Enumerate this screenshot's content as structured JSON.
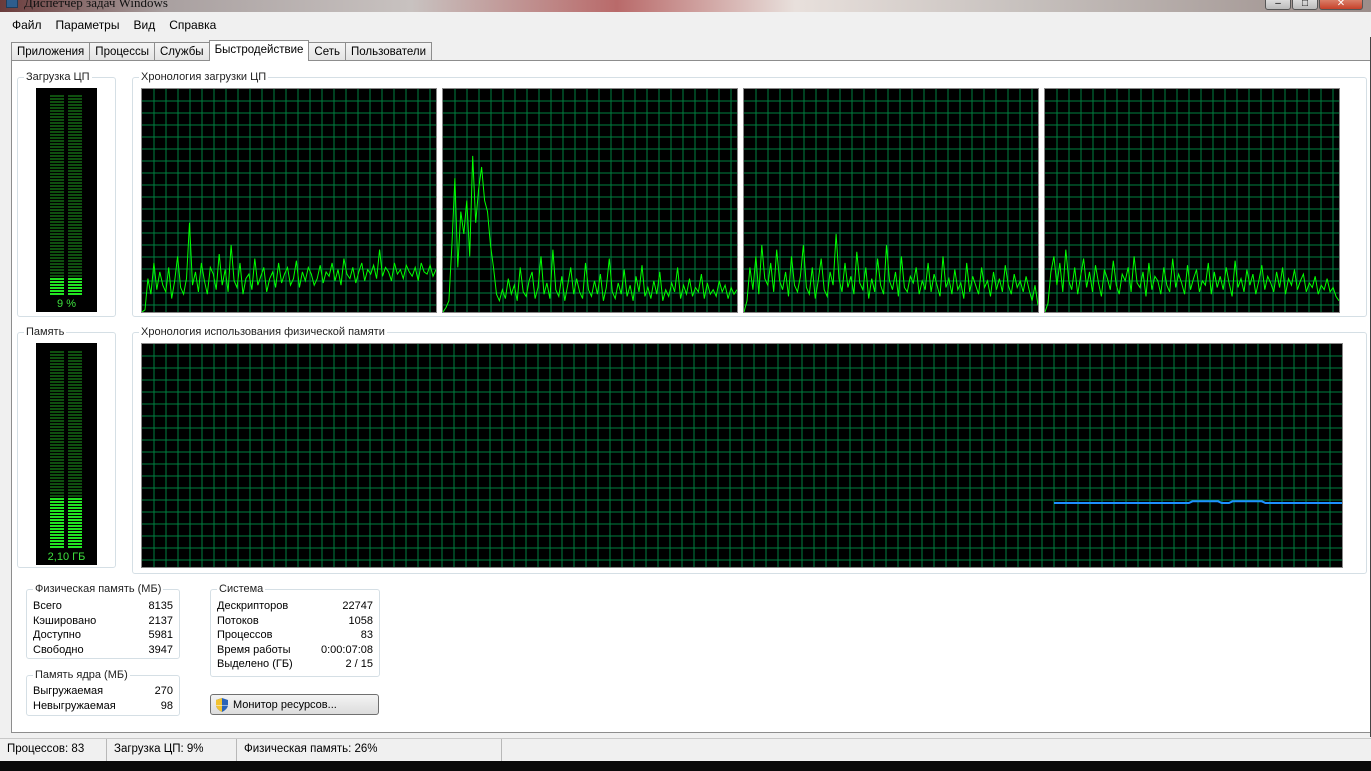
{
  "window": {
    "title": "Диспетчер задач Windows"
  },
  "menu": [
    "Файл",
    "Параметры",
    "Вид",
    "Справка"
  ],
  "tabs": [
    "Приложения",
    "Процессы",
    "Службы",
    "Быстродействие",
    "Сеть",
    "Пользователи"
  ],
  "active_tab": "Быстродействие",
  "cpu": {
    "label": "Загрузка ЦП",
    "value_text": "9 %",
    "level": 0.09,
    "history_label": "Хронология загрузки ЦП",
    "cores": [
      [
        0,
        1,
        15,
        8,
        22,
        10,
        18,
        12,
        9,
        20,
        6,
        14,
        25,
        11,
        8,
        15,
        40,
        12,
        18,
        9,
        22,
        14,
        8,
        20,
        17,
        10,
        26,
        12,
        19,
        9,
        30,
        14,
        11,
        22,
        8,
        15,
        17,
        10,
        24,
        12,
        16,
        20,
        9,
        15,
        18,
        11,
        22,
        13,
        17,
        20,
        12,
        15,
        23,
        11,
        18,
        14,
        20,
        17,
        12,
        15,
        21,
        13,
        18,
        16,
        22,
        14,
        19,
        12,
        24,
        17,
        15,
        20,
        13,
        18,
        22,
        14,
        19,
        17,
        21,
        15,
        28,
        16,
        20,
        18,
        14,
        22,
        17,
        19,
        15,
        21,
        18,
        16,
        20,
        14,
        22,
        18,
        17,
        21,
        16,
        19
      ],
      [
        0,
        2,
        5,
        30,
        60,
        20,
        45,
        35,
        50,
        25,
        70,
        40,
        55,
        65,
        50,
        45,
        30,
        20,
        8,
        5,
        10,
        6,
        15,
        8,
        12,
        5,
        20,
        9,
        7,
        14,
        18,
        6,
        11,
        25,
        8,
        13,
        6,
        28,
        10,
        7,
        16,
        5,
        12,
        20,
        8,
        15,
        9,
        6,
        22,
        10,
        7,
        14,
        8,
        17,
        5,
        11,
        24,
        9,
        6,
        13,
        8,
        19,
        7,
        12,
        5,
        16,
        9,
        21,
        7,
        11,
        6,
        14,
        8,
        18,
        5,
        10,
        7,
        13,
        9,
        20,
        6,
        12,
        8,
        15,
        7,
        11,
        9,
        17,
        6,
        13,
        8,
        10,
        7,
        14,
        9,
        12,
        6,
        11,
        8,
        10
      ],
      [
        0,
        5,
        20,
        10,
        25,
        8,
        30,
        15,
        12,
        22,
        9,
        28,
        14,
        10,
        18,
        7,
        25,
        12,
        9,
        16,
        30,
        11,
        8,
        20,
        6,
        14,
        24,
        10,
        7,
        18,
        12,
        35,
        15,
        9,
        22,
        11,
        16,
        8,
        27,
        13,
        10,
        20,
        6,
        15,
        9,
        24,
        12,
        8,
        30,
        14,
        10,
        18,
        7,
        25,
        11,
        9,
        16,
        13,
        20,
        8,
        14,
        10,
        22,
        9,
        17,
        12,
        7,
        25,
        11,
        15,
        8,
        19,
        10,
        13,
        6,
        22,
        9,
        16,
        12,
        8,
        20,
        11,
        14,
        7,
        18,
        10,
        15,
        9,
        21,
        12,
        8,
        17,
        11,
        14,
        9,
        16,
        10,
        5,
        12,
        3
      ],
      [
        0,
        4,
        18,
        25,
        12,
        22,
        9,
        28,
        14,
        10,
        20,
        8,
        16,
        24,
        11,
        18,
        9,
        21,
        13,
        7,
        19,
        15,
        10,
        23,
        12,
        8,
        17,
        14,
        20,
        9,
        25,
        13,
        11,
        18,
        7,
        22,
        10,
        16,
        14,
        8,
        20,
        12,
        9,
        24,
        11,
        17,
        13,
        8,
        21,
        10,
        15,
        19,
        9,
        14,
        12,
        22,
        8,
        18,
        11,
        16,
        10,
        20,
        13,
        7,
        23,
        11,
        15,
        9,
        19,
        12,
        17,
        8,
        14,
        21,
        10,
        16,
        13,
        9,
        18,
        11,
        20,
        8,
        15,
        12,
        19,
        10,
        14,
        17,
        9,
        13,
        11,
        16,
        8,
        12,
        10,
        15,
        9,
        11,
        7,
        5
      ]
    ]
  },
  "memory": {
    "label": "Память",
    "value_text": "2,10 ГБ",
    "level": 0.26,
    "history_label": "Хронология использования физической памяти",
    "history": [
      26,
      26,
      26,
      26,
      26,
      26,
      26,
      26,
      26,
      26,
      26,
      26,
      26,
      26,
      26,
      26,
      26,
      26,
      26,
      26,
      26,
      26,
      26,
      26,
      26,
      26,
      26,
      26,
      26,
      26,
      26,
      26,
      26,
      26,
      26,
      26,
      26,
      26,
      27,
      27,
      27,
      27,
      27,
      27,
      27,
      27,
      26,
      26,
      26,
      27,
      27,
      27,
      27,
      27,
      27,
      27,
      27,
      27,
      26,
      26,
      26,
      26,
      26,
      26,
      26,
      26,
      26,
      26,
      26,
      26,
      26,
      26,
      26,
      26,
      26,
      26,
      26,
      26,
      26,
      26
    ]
  },
  "physical_memory": {
    "label": "Физическая память (МБ)",
    "rows": [
      {
        "key": "Всего",
        "value": "8135"
      },
      {
        "key": "Кэшировано",
        "value": "2137"
      },
      {
        "key": "Доступно",
        "value": "5981"
      },
      {
        "key": "Свободно",
        "value": "3947"
      }
    ]
  },
  "kernel_memory": {
    "label": "Память ядра (МБ)",
    "rows": [
      {
        "key": "Выгружаемая",
        "value": "270"
      },
      {
        "key": "Невыгружаемая",
        "value": "98"
      }
    ]
  },
  "system": {
    "label": "Система",
    "rows": [
      {
        "key": "Дескрипторов",
        "value": "22747"
      },
      {
        "key": "Потоков",
        "value": "1058"
      },
      {
        "key": "Процессов",
        "value": "83"
      },
      {
        "key": "Время работы",
        "value": "0:00:07:08"
      },
      {
        "key": "Выделено (ГБ)",
        "value": "2 / 15"
      }
    ]
  },
  "resource_monitor_button": "Монитор ресурсов...",
  "statusbar": {
    "processes": "Процессов: 83",
    "cpu": "Загрузка ЦП: 9%",
    "memory": "Физическая память: 26%"
  },
  "colors": {
    "grid": "#008040",
    "cpu_line": "#00ff00",
    "mem_line": "#1e90ff",
    "meter_on": "#22e622",
    "meter_off": "#0f4f0f"
  }
}
